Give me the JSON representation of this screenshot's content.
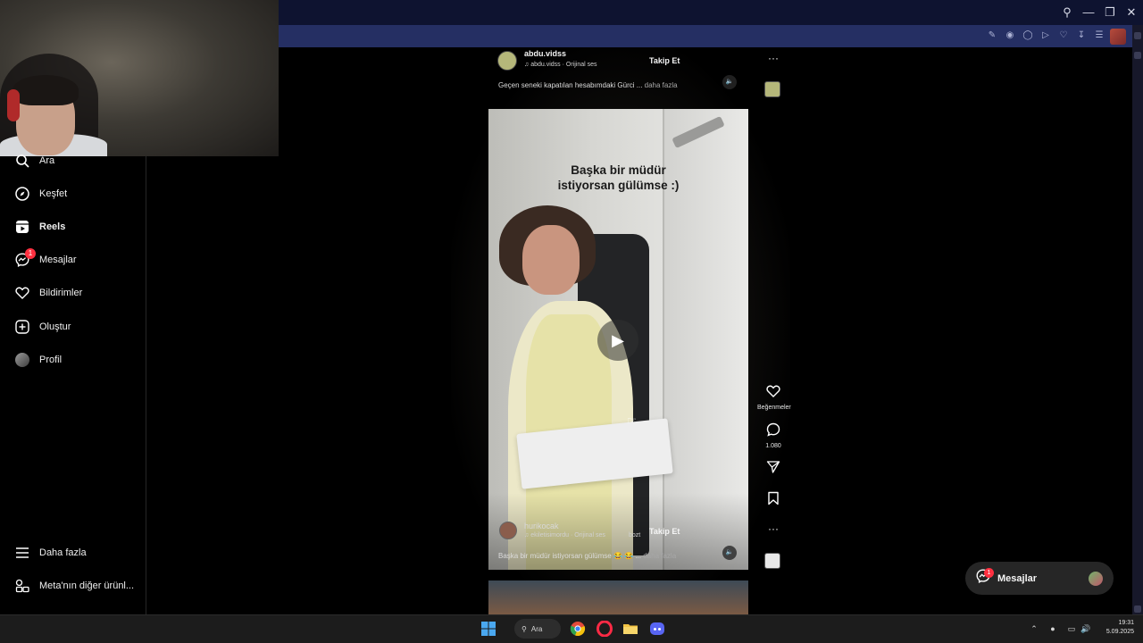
{
  "webcam": {
    "label": ""
  },
  "sidebar": {
    "items": [
      {
        "label": "Ara",
        "icon": "search-icon"
      },
      {
        "label": "Keşfet",
        "icon": "compass-icon"
      },
      {
        "label": "Reels",
        "icon": "reels-icon"
      },
      {
        "label": "Mesajlar",
        "icon": "messenger-icon",
        "badge": "1"
      },
      {
        "label": "Bildirimler",
        "icon": "heart-icon"
      },
      {
        "label": "Oluştur",
        "icon": "plus-square-icon"
      },
      {
        "label": "Profil",
        "icon": "avatar-icon"
      }
    ],
    "bottom": [
      {
        "label": "Daha fazla",
        "icon": "menu-icon"
      },
      {
        "label": "Meta'nın diğer ürünl...",
        "icon": "apps-icon"
      }
    ]
  },
  "post_top": {
    "username": "abdu.vidss",
    "audio": "abdu.vidss · Orijinal ses",
    "follow": "Takip Et",
    "caption": "Geçen seneki kapatılan hesabımdaki Gürci ...",
    "more": "daha fazla"
  },
  "video": {
    "overlay_line1": "Başka bir müdür",
    "overlay_line2": "istiyorsan gülümse :)"
  },
  "post_bottom": {
    "username": "hurikocak",
    "audio": "ekiletisimordu · Orijinal ses",
    "extra": "bozt",
    "follow": "Takip Et",
    "caption": "Başka bir müdür istiyorsan gülümse 😂 😂 ...",
    "more": "daha fazla"
  },
  "actions": {
    "like_label": "Beğenmeler",
    "comment_count": "1.080",
    "more": "···"
  },
  "messages_pill": {
    "label": "Mesajlar",
    "badge": "1"
  },
  "taskbar": {
    "search_label": "Ara",
    "time": "19:31",
    "date": "5.09.2025"
  }
}
